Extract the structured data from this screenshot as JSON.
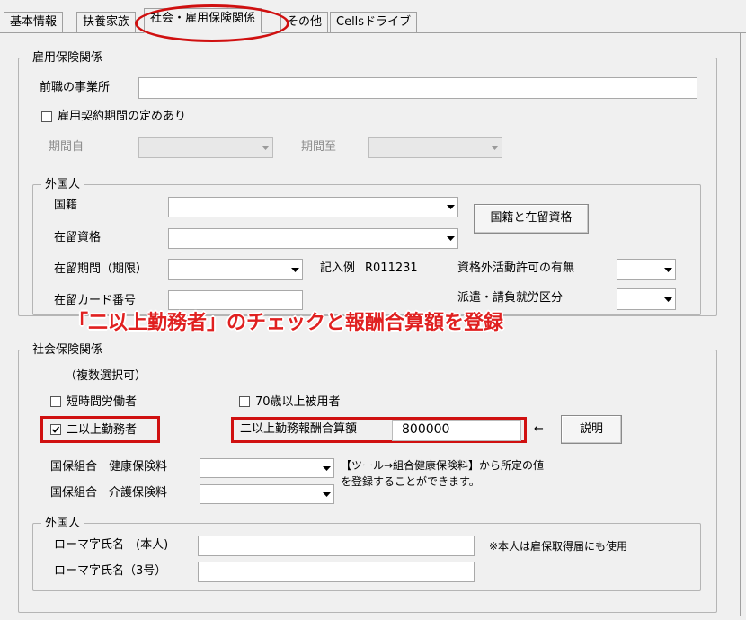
{
  "tabs": [
    "基本情報",
    "扶養家族",
    "社会・雇用保険関係",
    "その他",
    "Cellsドライブ"
  ],
  "employment": {
    "title": "雇用保険関係",
    "prev_office_label": "前職の事業所",
    "prev_office_value": "",
    "contract_period_label": "雇用契約期間の定めあり",
    "contract_period_checked": false,
    "period_from_label": "期間自",
    "period_to_label": "期間至"
  },
  "foreigner1": {
    "title": "外国人",
    "nationality_label": "国籍",
    "status_label": "在留資格",
    "nationality_status_button": "国籍と在留資格",
    "stay_period_label": "在留期間（期限）",
    "example_label": "記入例",
    "example_value": "R011231",
    "permission_label": "資格外活動許可の有無",
    "card_number_label": "在留カード番号",
    "dispatch_label": "派遣・請負就労区分"
  },
  "banner": "「二以上勤務者」のチェックと報酬合算額を登録",
  "social": {
    "title": "社会保険関係",
    "multi_select_note": "（複数選択可）",
    "short_time_label": "短時間労働者",
    "short_time_checked": false,
    "over70_label": "70歳以上被用者",
    "over70_checked": false,
    "multi_work_label": "二以上勤務者",
    "multi_work_checked": true,
    "total_pay_label": "二以上勤務報酬合算額",
    "total_pay_value": "800000",
    "arrow": "←",
    "explain_button": "説明",
    "kokuho_health_label": "国保組合　健康保険料",
    "kokuho_care_label": "国保組合　介護保険料",
    "note_line1": "【ツール→組合健康保険料】から所定の値",
    "note_line2": "を登録することができます。"
  },
  "foreigner2": {
    "title": "外国人",
    "romaji_self_label": "ローマ字氏名　(本人)",
    "romaji_self_value": "",
    "romaji_no3_label": "ローマ字氏名（3号）",
    "romaji_no3_value": "",
    "romaji_note": "※本人は雇保取得届にも使用"
  },
  "colors": {
    "annotation_red": "#d01010",
    "banner_red": "#e02020"
  }
}
